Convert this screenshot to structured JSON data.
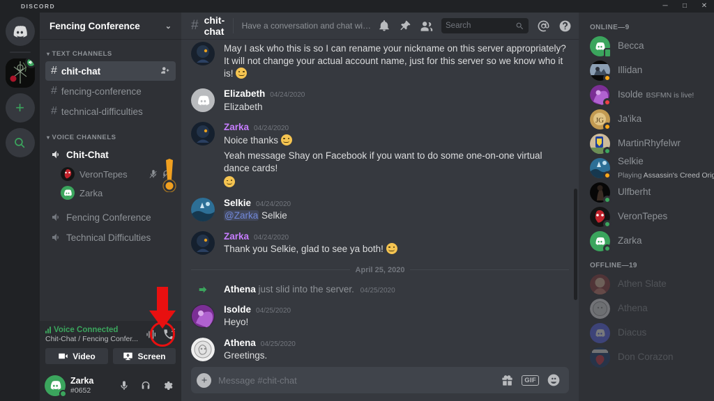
{
  "window": {
    "brand": "DISCORD",
    "controls": {
      "minimize": "─",
      "maximize": "□",
      "close": "✕"
    }
  },
  "rail": {
    "home_tooltip": "Home",
    "servers": [
      {
        "name": "Fencing Conference",
        "active": true,
        "voice_badge": true
      }
    ],
    "add_label": "+",
    "explore_label": "Explore Public Servers"
  },
  "sidebar": {
    "guild_name": "Fencing Conference",
    "chevron": "⌄",
    "categories": [
      {
        "label": "TEXT CHANNELS",
        "channels": [
          {
            "name": "chit-chat",
            "type": "text",
            "active": true,
            "has_invite": true
          },
          {
            "name": "fencing-conference",
            "type": "text",
            "active": false
          },
          {
            "name": "technical-difficulties",
            "type": "text",
            "active": false
          }
        ]
      },
      {
        "label": "VOICE CHANNELS",
        "channels": [
          {
            "name": "Chit-Chat",
            "type": "voice",
            "active": true,
            "users": [
              {
                "name": "VeronTepes",
                "muted": true,
                "deafened": true
              },
              {
                "name": "Zarka",
                "muted": false,
                "deafened": false
              }
            ]
          },
          {
            "name": "Fencing Conference",
            "type": "voice",
            "active": false,
            "users": []
          },
          {
            "name": "Technical Difficulties",
            "type": "voice",
            "active": false,
            "users": []
          }
        ]
      }
    ]
  },
  "voice_panel": {
    "status": "Voice Connected",
    "location": "Chit-Chat / Fencing Confer...",
    "ping_icon": "signal-bars-icon",
    "noise_icon": "soundwave-icon",
    "disconnect_icon": "phone-disconnect-icon",
    "video_label": "Video",
    "screen_label": "Screen"
  },
  "user_panel": {
    "username": "Zarka",
    "discriminator": "#0652",
    "mute_icon": "microphone-icon",
    "deafen_icon": "headphones-icon",
    "settings_icon": "gear-icon"
  },
  "channel_header": {
    "hash": "#",
    "name": "chit-chat",
    "topic": "Have a conversation and chat with other members of the Order of the Rose ...",
    "icons": [
      "notification-bell-icon",
      "pin-icon",
      "members-icon",
      "mentions-icon",
      "help-icon"
    ]
  },
  "search": {
    "placeholder": "Search",
    "icon": "search-icon"
  },
  "messages": [
    {
      "id": "m1",
      "type": "message",
      "continued": true,
      "author": "",
      "time": "",
      "avatar_kind": "zarka-dark",
      "lines": [
        "May I ask who this is so I can rename your nickname on this server appropriately? It will not change your actual account name, just for this server so we know who it is!"
      ],
      "trailing_emoji": "slight-smile"
    },
    {
      "id": "m2",
      "type": "message",
      "continued": false,
      "author": "Elizabeth",
      "time": "04/24/2020",
      "author_color": "#ffffff",
      "avatar_kind": "discord-gray",
      "lines": [
        "Elizabeth"
      ]
    },
    {
      "id": "m3",
      "type": "message",
      "continued": false,
      "author": "Zarka",
      "time": "04/24/2020",
      "author_color": "#c77dff",
      "avatar_kind": "zarka-dark",
      "lines": [
        "Noice thanks"
      ],
      "trailing_emoji": "slight-smile"
    },
    {
      "id": "m4",
      "type": "message",
      "continued": true,
      "author": "",
      "time": "",
      "avatar_kind": "none",
      "lines": [
        "Yeah message Shay on Facebook if you want to do some one-on-one virtual dance cards!"
      ],
      "emoji_below": "wink"
    },
    {
      "id": "m5",
      "type": "message",
      "continued": false,
      "author": "Selkie",
      "time": "04/24/2020",
      "author_color": "#ffffff",
      "avatar_kind": "selkie-blue",
      "mention": "@Zarka",
      "lines": [
        "Selkie"
      ]
    },
    {
      "id": "m6",
      "type": "message",
      "continued": false,
      "author": "Zarka",
      "time": "04/24/2020",
      "author_color": "#c77dff",
      "avatar_kind": "zarka-dark",
      "lines": [
        "Thank you Selkie, glad to see ya both!"
      ],
      "trailing_emoji": "slight-smile"
    },
    {
      "id": "d1",
      "type": "date-divider",
      "label": "April 25, 2020"
    },
    {
      "id": "m7",
      "type": "system-join",
      "author": "Athena",
      "text": "just slid into the server.",
      "time": "04/25/2020"
    },
    {
      "id": "m8",
      "type": "message",
      "continued": false,
      "author": "Isolde",
      "time": "04/25/2020",
      "author_color": "#ffffff",
      "avatar_kind": "isolde-purple",
      "lines": [
        "Heyo!"
      ]
    },
    {
      "id": "m9",
      "type": "message",
      "continued": false,
      "author": "Athena",
      "time": "04/25/2020",
      "author_color": "#ffffff",
      "avatar_kind": "athena-white",
      "lines": [
        "Greetings."
      ]
    }
  ],
  "composer": {
    "placeholder": "Message #chit-chat",
    "plus_icon": "add-attachment-icon",
    "gift_icon": "gift-icon",
    "gif_label": "GIF",
    "emoji_icon": "emoji-icon"
  },
  "members": {
    "online_label": "ONLINE—09",
    "online_label_text": "ONLINE—9",
    "offline_label": "OFFLINE—19",
    "online": [
      {
        "name": "Becca",
        "status": "mobile",
        "avatar_kind": "discord-green",
        "activity": ""
      },
      {
        "name": "Illidan",
        "status": "idle",
        "avatar_kind": "illidan",
        "activity": ""
      },
      {
        "name": "Isolde",
        "status": "dnd",
        "avatar_kind": "isolde-purple",
        "activity": "BSFMN is live!"
      },
      {
        "name": "Ja'ika",
        "status": "idle",
        "avatar_kind": "jaika",
        "activity": ""
      },
      {
        "name": "MartinRhyfelwr",
        "status": "online",
        "avatar_kind": "martin",
        "activity": ""
      },
      {
        "name": "Selkie",
        "status": "idle",
        "avatar_kind": "selkie-blue",
        "activity": "Playing Assassin's Creed Origi...",
        "activity_prefix": "Playing ",
        "activity_game": "Assassin's Creed Origi..."
      },
      {
        "name": "Ulfberht",
        "status": "online",
        "avatar_kind": "ulfberht",
        "activity": ""
      },
      {
        "name": "VeronTepes",
        "status": "online",
        "avatar_kind": "verontepes",
        "activity": ""
      },
      {
        "name": "Zarka",
        "status": "online",
        "avatar_kind": "discord-green",
        "activity": ""
      }
    ],
    "offline": [
      {
        "name": "Athen Slate",
        "avatar_kind": "athenslate"
      },
      {
        "name": "Athena",
        "avatar_kind": "athena-white"
      },
      {
        "name": "Diacus",
        "avatar_kind": "discord-blurple"
      },
      {
        "name": "Don Corazon",
        "avatar_kind": "doncorazon"
      }
    ]
  },
  "annotations": [
    {
      "name": "exclamation-marker",
      "color": "#f0a020",
      "target": "voice-user-row"
    },
    {
      "name": "arrow-marker",
      "color": "#e81010",
      "target": "disconnect-button"
    },
    {
      "name": "circle-marker",
      "color": "#e81010",
      "target": "disconnect-button"
    }
  ],
  "colors": {
    "rail_bg": "#202225",
    "sidebar_bg": "#2f3136",
    "chat_bg": "#36393f",
    "accent_green": "#3ba55d",
    "annotation_red": "#e81010",
    "annotation_orange": "#f0a020"
  }
}
